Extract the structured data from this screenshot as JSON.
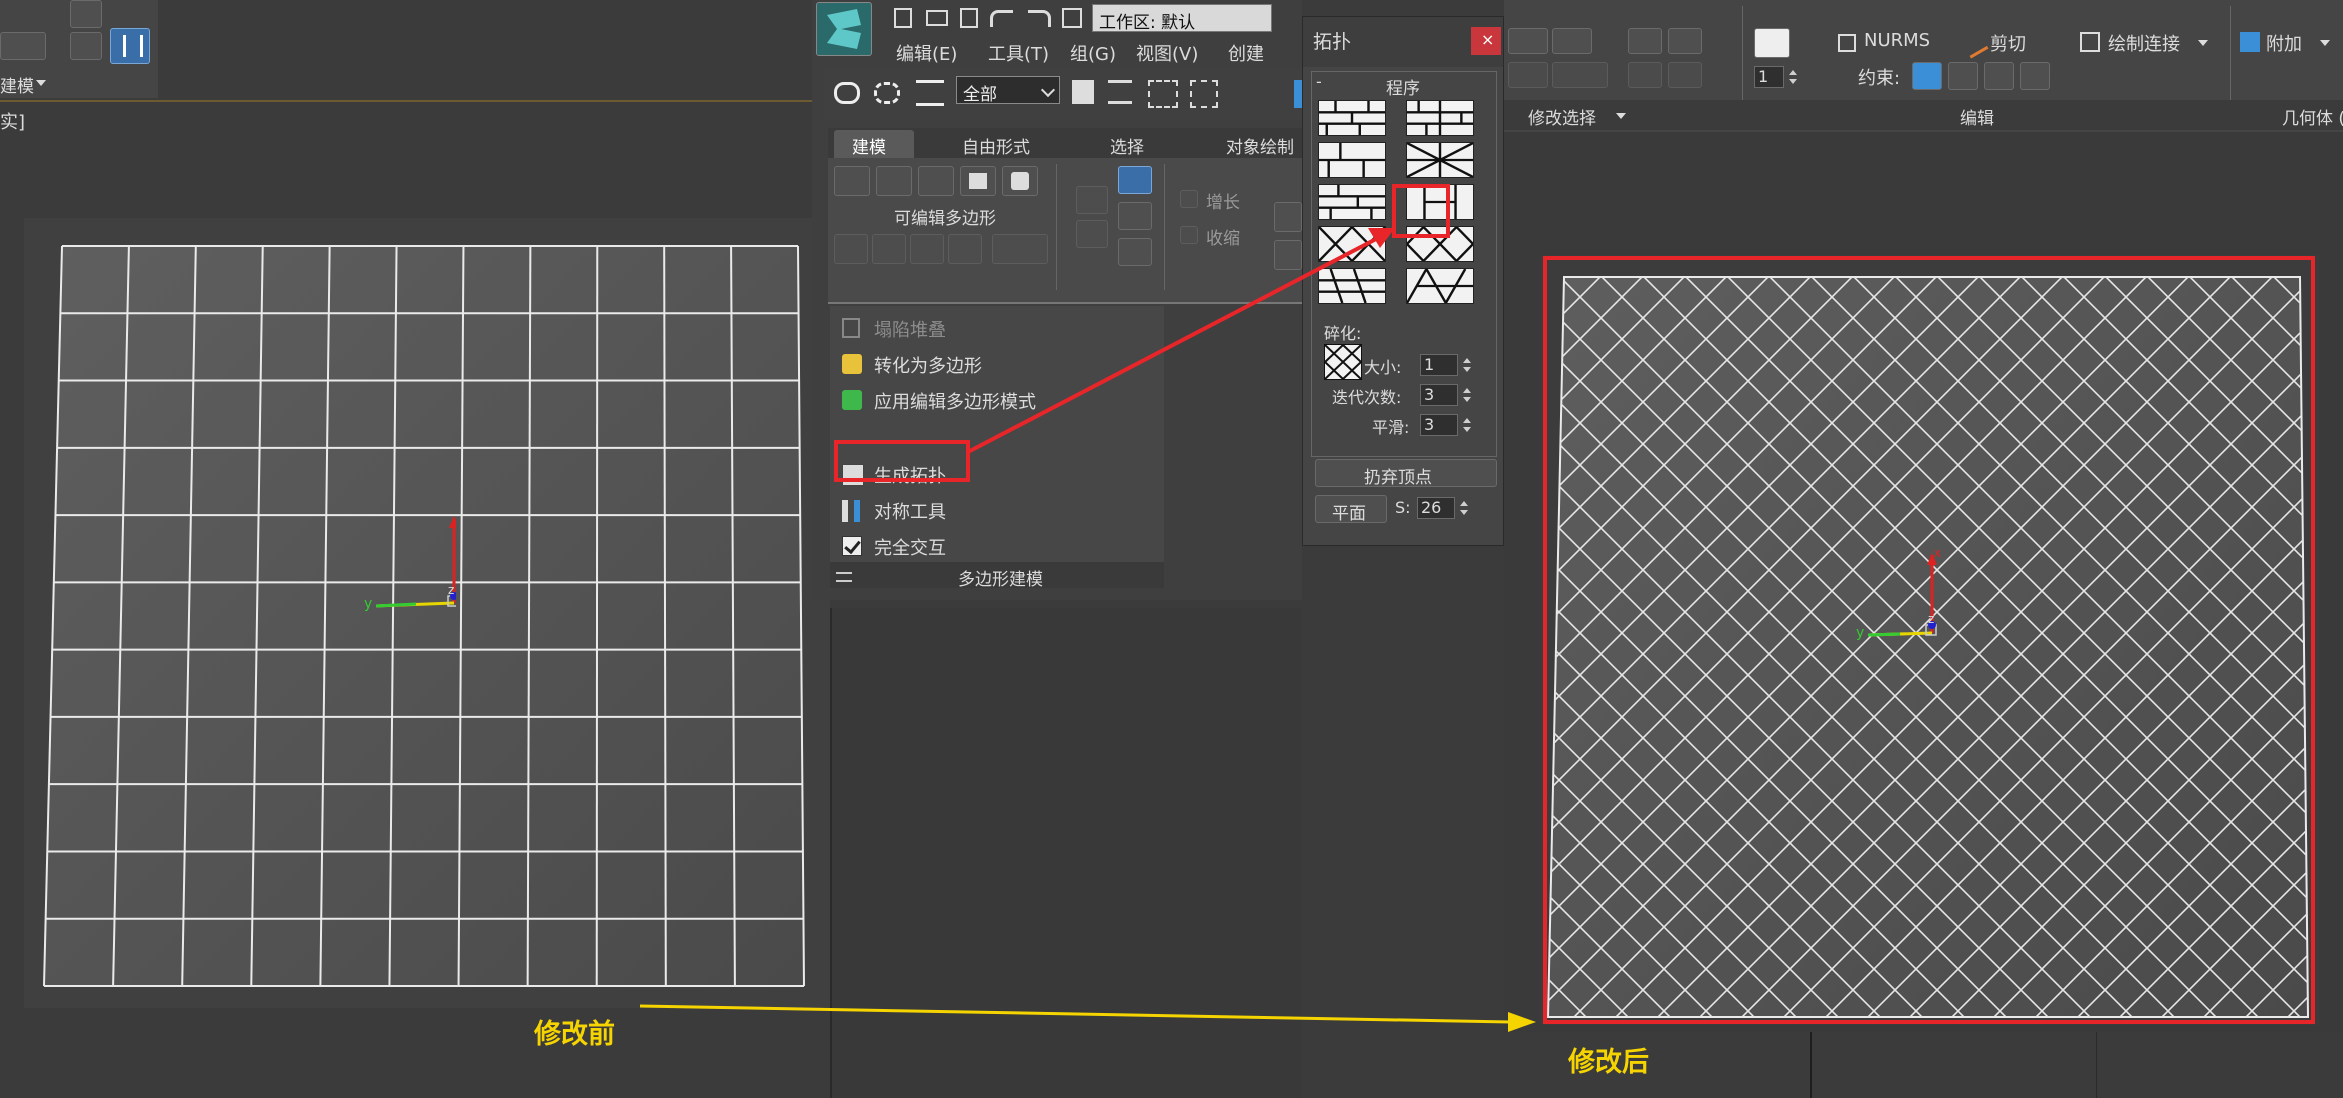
{
  "top_left": {
    "section_label": "建模"
  },
  "viewport_label": "实]",
  "app_menu": {
    "workspace_label": "工作区: 默认",
    "menu": [
      "编辑(E)",
      "工具(T)",
      "组(G)",
      "视图(V)",
      "创建"
    ],
    "selection_filter": "全部"
  },
  "ribbon": {
    "tabs": [
      "建模",
      "自由形式",
      "选择",
      "对象绘制"
    ],
    "editable_poly_label": "可编辑多边形",
    "grow_label": "增长",
    "shrink_label": "收缩",
    "menu_items": [
      "塌陷堆叠",
      "转化为多边形",
      "应用编辑多边形模式",
      "生成拓扑",
      "对称工具",
      "完全交互"
    ],
    "footer_label": "多边形建模"
  },
  "topology_dialog": {
    "title": "拓扑",
    "section": "程序",
    "tessellate_label": "碎化:",
    "size_label": "大小:",
    "size_value": "1",
    "iterations_label": "迭代次数:",
    "iterations_value": "3",
    "smooth_label": "平滑:",
    "smooth_value": "3",
    "discard_vertices_label": "扔弃顶点",
    "flat_label": "平面",
    "s_label": "S:",
    "s_value": "26"
  },
  "right_ribbon": {
    "nurms_label": "NURMS",
    "cut_label": "剪切",
    "paint_connect_label": "绘制连接",
    "attach_label": "附加",
    "constraint_label": "约束:",
    "spinner_value": "1",
    "modify_selection_label": "修改选择",
    "edit_label": "编辑",
    "geometry_label": "几何体 ("
  },
  "annotations": {
    "before_label": "修改前",
    "after_label": "修改后"
  },
  "axes": {
    "x": "x",
    "y": "y",
    "z": "z"
  },
  "colors": {
    "highlight_red": "#e8262a",
    "arrow_yellow": "#f5d400",
    "accent_blue": "#3a8fd6"
  }
}
